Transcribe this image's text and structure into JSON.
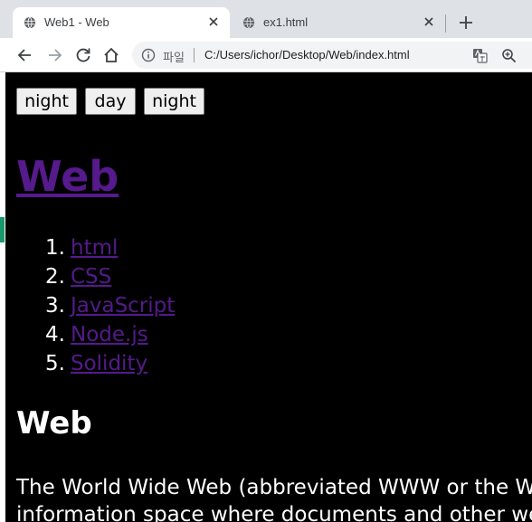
{
  "browser": {
    "tabs": [
      {
        "title": "Web1 - Web",
        "active": true,
        "icon": "globe-icon"
      },
      {
        "title": "ex1.html",
        "active": false,
        "icon": "globe-icon"
      }
    ],
    "address": {
      "scheme_label": "파일",
      "url": "C:/Users/ichor/Desktop/Web/index.html"
    }
  },
  "page": {
    "mode_buttons": [
      "night",
      "day",
      "night"
    ],
    "heading": "Web",
    "nav_items": [
      {
        "num": "1.",
        "label": "html"
      },
      {
        "num": "2.",
        "label": "CSS"
      },
      {
        "num": "3.",
        "label": "JavaScript"
      },
      {
        "num": "4.",
        "label": "Node.js"
      },
      {
        "num": "5.",
        "label": "Solidity"
      }
    ],
    "subheading": "Web",
    "paragraph_lines": [
      "The World Wide Web (abbreviated WWW or the Web) is an",
      "information space where documents and other web resources"
    ]
  },
  "colors": {
    "page_background": "#000000",
    "visited_link": "#551a8b",
    "text": "#ffffff"
  }
}
